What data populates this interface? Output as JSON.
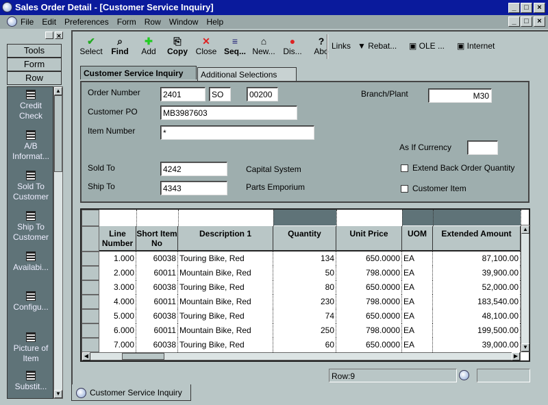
{
  "window": {
    "title": "Sales Order Detail - [Customer Service Inquiry]",
    "controls": [
      "_",
      "□",
      "×"
    ]
  },
  "menu": [
    "File",
    "Edit",
    "Preferences",
    "Form",
    "Row",
    "Window",
    "Help"
  ],
  "sidebar": {
    "buttons": [
      "Tools",
      "Form",
      "Row"
    ],
    "items": [
      "Credit Check",
      "A/B Informat...",
      "Sold To Customer",
      "Ship To Customer",
      "Availabi...",
      "Configu...",
      "Picture of Item",
      "Substit..."
    ]
  },
  "toolbar": {
    "buttons": [
      {
        "label": "Select",
        "icon": "✔"
      },
      {
        "label": "Find",
        "icon": "⌕"
      },
      {
        "label": "Add",
        "icon": "✚"
      },
      {
        "label": "Copy",
        "icon": "⎘"
      },
      {
        "label": "Close",
        "icon": "✕"
      },
      {
        "label": "Seq...",
        "icon": "≡"
      },
      {
        "label": "New...",
        "icon": "⌂"
      },
      {
        "label": "Dis...",
        "icon": "●"
      },
      {
        "label": "Abo",
        "icon": "?"
      }
    ],
    "links_label": "Links",
    "rebat": "Rebat...",
    "ole": "OLE ...",
    "internet": "Internet"
  },
  "tabs": [
    "Customer Service Inquiry",
    "Additional Selections"
  ],
  "form": {
    "order_number_label": "Order Number",
    "order_number": "2401",
    "order_type": "SO",
    "order_company": "00200",
    "branch_label": "Branch/Plant",
    "branch": "M30",
    "customer_po_label": "Customer PO",
    "customer_po": "MB3987603",
    "item_number_label": "Item Number",
    "item_number": "*",
    "currency_label": "As If Currency",
    "currency": "",
    "sold_to_label": "Sold To",
    "sold_to": "4242",
    "sold_to_name": "Capital System",
    "ship_to_label": "Ship To",
    "ship_to": "4343",
    "ship_to_name": "Parts Emporium",
    "extend_label": "Extend Back Order Quantity",
    "customer_item_label": "Customer Item"
  },
  "grid": {
    "columns": [
      "Line Number",
      "Short Item No",
      "Description 1",
      "Quantity",
      "Unit Price",
      "UOM",
      "Extended Amount"
    ],
    "rows": [
      [
        "1.000",
        "60038",
        "Touring Bike, Red",
        "134",
        "650.0000",
        "EA",
        "87,100.00"
      ],
      [
        "2.000",
        "60011",
        "Mountain Bike, Red",
        "50",
        "798.0000",
        "EA",
        "39,900.00"
      ],
      [
        "3.000",
        "60038",
        "Touring Bike, Red",
        "80",
        "650.0000",
        "EA",
        "52,000.00"
      ],
      [
        "4.000",
        "60011",
        "Mountain Bike, Red",
        "230",
        "798.0000",
        "EA",
        "183,540.00"
      ],
      [
        "5.000",
        "60038",
        "Touring Bike, Red",
        "74",
        "650.0000",
        "EA",
        "48,100.00"
      ],
      [
        "6.000",
        "60011",
        "Mountain Bike, Red",
        "250",
        "798.0000",
        "EA",
        "199,500.00"
      ],
      [
        "7.000",
        "60038",
        "Touring Bike, Red",
        "60",
        "650.0000",
        "EA",
        "39,000.00"
      ]
    ]
  },
  "status": {
    "row": "Row:9"
  },
  "bottom_tab": "Customer Service Inquiry",
  "colors": {
    "titlebar": "#0a1a9c",
    "sidebar": "#5f7378",
    "background": "#b9c6c6"
  }
}
